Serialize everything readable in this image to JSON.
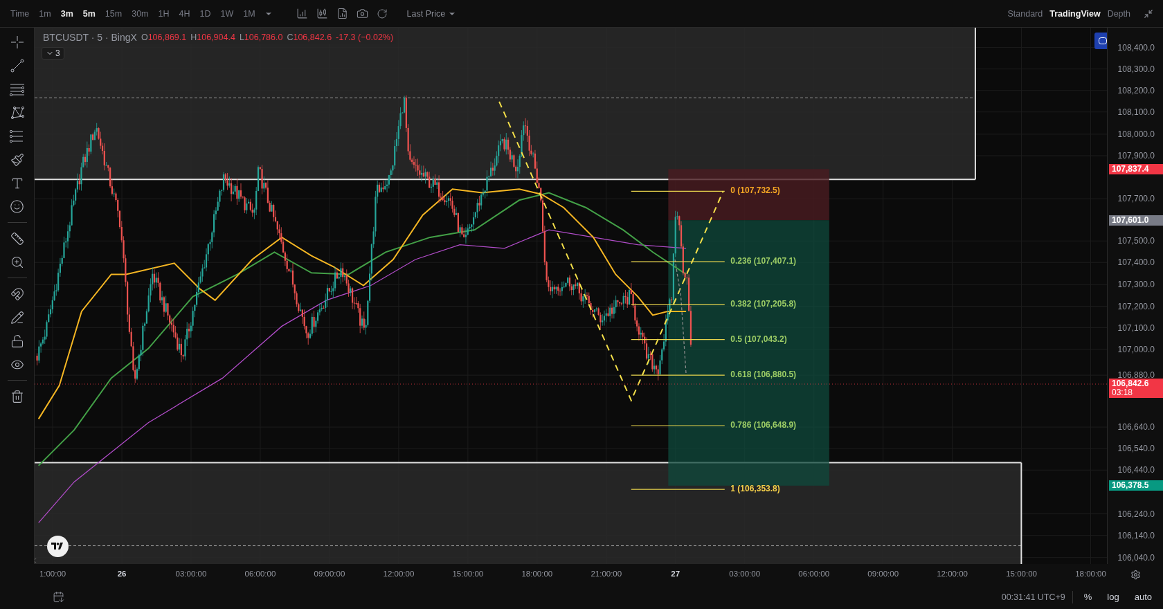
{
  "toolbar": {
    "time_label": "Time",
    "intervals": [
      {
        "label": "1m",
        "selected": false
      },
      {
        "label": "3m",
        "selected": true
      },
      {
        "label": "5m",
        "selected": true
      },
      {
        "label": "15m",
        "selected": false
      },
      {
        "label": "30m",
        "selected": false
      },
      {
        "label": "1H",
        "selected": false
      },
      {
        "label": "4H",
        "selected": false
      },
      {
        "label": "1D",
        "selected": false
      },
      {
        "label": "1W",
        "selected": false
      },
      {
        "label": "1M",
        "selected": false
      }
    ],
    "price_source": "Last Price"
  },
  "view_modes": [
    {
      "label": "Standard",
      "selected": false
    },
    {
      "label": "TradingView",
      "selected": true
    },
    {
      "label": "Depth",
      "selected": false
    }
  ],
  "legend": {
    "symbol": "BTCUSDT · 5 · BingX",
    "values": [
      {
        "label": "O",
        "value": "106,869.1"
      },
      {
        "label": "H",
        "value": "106,904.4"
      },
      {
        "label": "L",
        "value": "106,786.0"
      },
      {
        "label": "C",
        "value": "106,842.6"
      }
    ],
    "change": "-17.3 (−0.02%)",
    "indicators_count": "3"
  },
  "fib_levels": [
    {
      "label": "0 (107,732.5)",
      "color": "#f5a623"
    },
    {
      "label": "0.236 (107,407.1)",
      "color": "#9ccc65"
    },
    {
      "label": "0.382 (107,205.8)",
      "color": "#9ccc65"
    },
    {
      "label": "0.5 (107,043.2)",
      "color": "#9ccc65"
    },
    {
      "label": "0.618 (106,880.5)",
      "color": "#9ccc65"
    },
    {
      "label": "0.786 (106,648.9)",
      "color": "#9ccc65"
    },
    {
      "label": "1 (106,353.8)",
      "color": "#f5d04a"
    }
  ],
  "price_axis": {
    "labels": [
      "108,400.0",
      "108,300.0",
      "108,200.0",
      "108,100.0",
      "108,000.0",
      "107,900.0",
      "107,700.0",
      "107,500.0",
      "107,400.0",
      "107,300.0",
      "107,200.0",
      "107,100.0",
      "107,000.0",
      "106,880.0",
      "106,640.0",
      "106,540.0",
      "106,440.0",
      "106,240.0",
      "106,140.0",
      "106,040.0"
    ],
    "tags": [
      {
        "value": "107,837.4",
        "color": "#f23645"
      },
      {
        "value": "107,601.0",
        "color": "#787b86"
      },
      {
        "value": "106,842.6",
        "countdown": "03:18",
        "color": "#f23645"
      },
      {
        "value": "106,378.5",
        "color": "#089981"
      }
    ]
  },
  "time_axis": [
    {
      "label": "1:00:00",
      "kind": "time"
    },
    {
      "label": "26",
      "kind": "day"
    },
    {
      "label": "03:00:00",
      "kind": "time"
    },
    {
      "label": "06:00:00",
      "kind": "time"
    },
    {
      "label": "09:00:00",
      "kind": "time"
    },
    {
      "label": "12:00:00",
      "kind": "time"
    },
    {
      "label": "15:00:00",
      "kind": "time"
    },
    {
      "label": "18:00:00",
      "kind": "time"
    },
    {
      "label": "21:00:00",
      "kind": "time"
    },
    {
      "label": "27",
      "kind": "day"
    },
    {
      "label": "03:00:00",
      "kind": "time"
    },
    {
      "label": "06:00:00",
      "kind": "time"
    },
    {
      "label": "09:00:00",
      "kind": "time"
    },
    {
      "label": "12:00:00",
      "kind": "time"
    },
    {
      "label": "15:00:00",
      "kind": "time"
    },
    {
      "label": "18:00:00",
      "kind": "time"
    }
  ],
  "status_bar": {
    "clock": "00:31:41 UTC+9",
    "percent": "%",
    "log": "log",
    "auto": "auto"
  }
}
